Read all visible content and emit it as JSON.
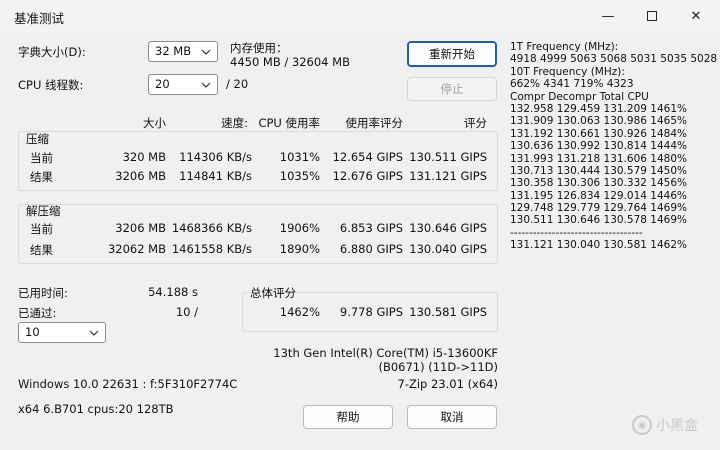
{
  "window": {
    "title": "基准测试",
    "min_glyph": "—",
    "close_glyph": "✕"
  },
  "settings": {
    "dict_label": "字典大小(D):",
    "dict_value": "32 MB",
    "threads_label": "CPU 线程数:",
    "threads_value": "20",
    "threads_total": "/ 20",
    "mem_label": "内存使用：",
    "mem_value": "4450 MB / 32604 MB"
  },
  "buttons": {
    "restart": "重新开始",
    "stop": "停止",
    "help": "帮助",
    "cancel": "取消"
  },
  "headers": {
    "size": "大小",
    "speed": "速度:",
    "cpu_usage": "CPU 使用率",
    "usage_rating": "使用率评分",
    "rating": "评分"
  },
  "compress": {
    "title": "压缩",
    "rows": [
      {
        "label": "当前",
        "size": "320 MB",
        "speed": "114306 KB/s",
        "cpu": "1031%",
        "usage": "12.654 GIPS",
        "rating": "130.511 GIPS"
      },
      {
        "label": "结果",
        "size": "3206 MB",
        "speed": "114841 KB/s",
        "cpu": "1035%",
        "usage": "12.676 GIPS",
        "rating": "131.121 GIPS"
      }
    ]
  },
  "decompress": {
    "title": "解压缩",
    "rows": [
      {
        "label": "当前",
        "size": "3206 MB",
        "speed": "1468366 KB/s",
        "cpu": "1906%",
        "usage": "6.853 GIPS",
        "rating": "130.646 GIPS"
      },
      {
        "label": "结果",
        "size": "32062 MB",
        "speed": "1461558 KB/s",
        "cpu": "1890%",
        "usage": "6.880 GIPS",
        "rating": "130.040 GIPS"
      }
    ]
  },
  "status": {
    "elapsed_label": "已用时间:",
    "elapsed_value": "54.188 s",
    "passed_label": "已通过:",
    "passed_value": "10 /",
    "passes_select": "10"
  },
  "total": {
    "title": "总体评分",
    "cpu": "1462%",
    "usage": "9.778 GIPS",
    "rating": "130.581 GIPS"
  },
  "sysinfo": {
    "cpu_name": "13th Gen Intel(R) Core(TM) i5-13600KF",
    "cpu_id": "(B0671) (11D->11D)",
    "os": "Windows 10.0 22631 : f:5F310F2774C",
    "version": "7-Zip 23.01 (x64)",
    "arch": "x64 6.B701 cpus:20 128TB"
  },
  "log": {
    "lines": [
      "1T Frequency (MHz):",
      " 4918 4999 5063 5068 5031 5035 5028",
      "10T Frequency (MHz):",
      " 662% 4341 719% 4323",
      "Compr Decompr Total   CPU",
      " 132.958  129.459  131.209  1461%",
      " 131.909  130.063  130.986  1465%",
      " 131.192  130.661  130.926  1484%",
      " 130.636  130.992  130.814  1444%",
      " 131.993  131.218  131.606  1480%",
      " 130.713  130.444  130.579  1450%",
      " 130.358  130.306  130.332  1456%",
      " 131.195  126.834  129.014  1446%",
      " 129.748  129.779  129.764  1469%",
      " 130.511  130.646  130.578  1469%",
      " -----------------------------------",
      " 131.121  130.040  130.581  1462%"
    ]
  },
  "watermark": {
    "text": "小黑盒"
  }
}
